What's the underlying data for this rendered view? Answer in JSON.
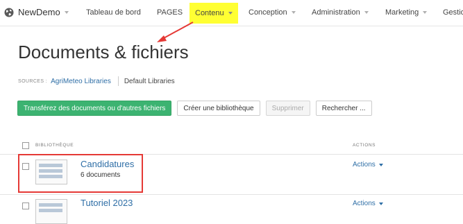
{
  "nav": {
    "brand": "NewDemo",
    "items": [
      {
        "label": "Tableau de bord"
      },
      {
        "label": "PAGES"
      },
      {
        "label": "Contenu"
      },
      {
        "label": "Conception"
      },
      {
        "label": "Administration"
      },
      {
        "label": "Marketing"
      },
      {
        "label": "Gestio"
      }
    ],
    "highlight_color": "#ffff33"
  },
  "page": {
    "title": "Documents & fichiers"
  },
  "sources": {
    "label": "SOURCES :",
    "active": "AgriMeteo Libraries",
    "other": "Default Libraries"
  },
  "toolbar": {
    "upload": "Transférez des documents ou d'autres fichiers",
    "create_library": "Créer une bibliothèque",
    "delete": "Supprimer",
    "search": "Rechercher ..."
  },
  "table": {
    "col_library": "BIBLIOTHÈQUE",
    "col_actions": "ACTIONS",
    "rows": [
      {
        "name": "Candidatures",
        "count": "6 documents",
        "actions": "Actions"
      },
      {
        "name": "Tutoriel 2023",
        "count": "",
        "actions": "Actions"
      }
    ]
  },
  "colors": {
    "primary_button": "#3cb371",
    "link": "#2e6ea6",
    "annotation_red": "#e53935"
  }
}
